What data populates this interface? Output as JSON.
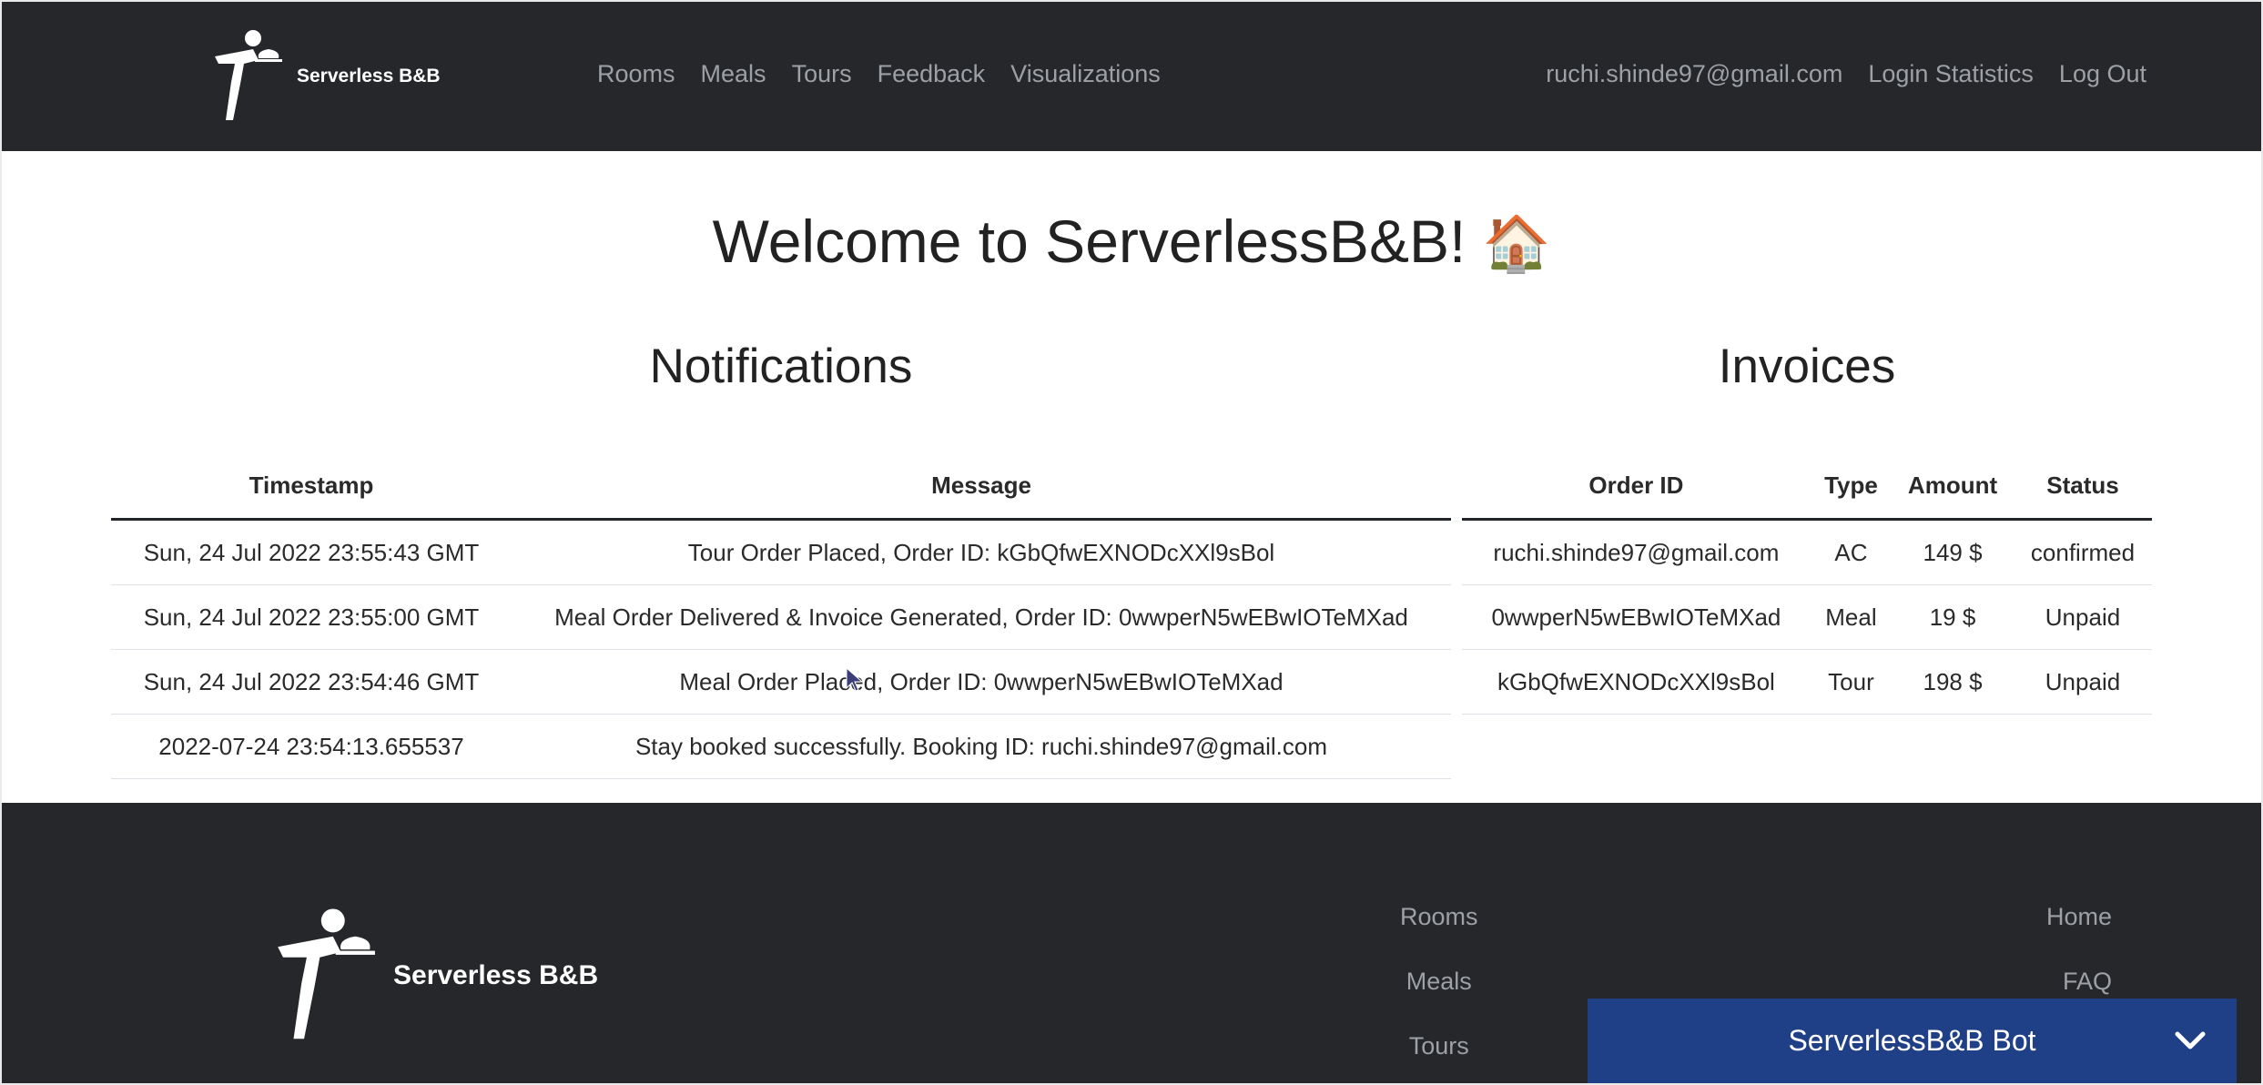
{
  "brand": {
    "name": "Serverless B&B",
    "logo_icon": "waiter-with-tray-icon"
  },
  "nav": {
    "links": [
      "Rooms",
      "Meals",
      "Tours",
      "Feedback",
      "Visualizations"
    ],
    "user_email": "ruchi.shinde97@gmail.com",
    "login_statistics": "Login Statistics",
    "logout": "Log Out"
  },
  "main": {
    "welcome": "Welcome to ServerlessB&B!",
    "welcome_emoji": "🏠",
    "notifications": {
      "title": "Notifications",
      "columns": [
        "Timestamp",
        "Message"
      ],
      "rows": [
        [
          "Sun, 24 Jul 2022 23:55:43 GMT",
          "Tour Order Placed, Order ID: kGbQfwEXNODcXXl9sBol"
        ],
        [
          "Sun, 24 Jul 2022 23:55:00 GMT",
          "Meal Order Delivered & Invoice Generated, Order ID: 0wwperN5wEBwIOTeMXad"
        ],
        [
          "Sun, 24 Jul 2022 23:54:46 GMT",
          "Meal Order Placed, Order ID: 0wwperN5wEBwIOTeMXad"
        ],
        [
          "2022-07-24 23:54:13.655537",
          "Stay booked successfully. Booking ID: ruchi.shinde97@gmail.com"
        ]
      ]
    },
    "invoices": {
      "title": "Invoices",
      "columns": [
        "Order ID",
        "Type",
        "Amount",
        "Status"
      ],
      "rows": [
        [
          "ruchi.shinde97@gmail.com",
          "AC",
          "149 $",
          "confirmed"
        ],
        [
          "0wwperN5wEBwIOTeMXad",
          "Meal",
          "19 $",
          "Unpaid"
        ],
        [
          "kGbQfwEXNODcXXl9sBol",
          "Tour",
          "198 $",
          "Unpaid"
        ]
      ]
    }
  },
  "footer": {
    "brand": "Serverless B&B",
    "col1": [
      "Rooms",
      "Meals",
      "Tours"
    ],
    "col2": [
      "Home",
      "FAQ"
    ]
  },
  "bot": {
    "title": "ServerlessB&B Bot",
    "toggle_icon": "chevron-down-icon"
  },
  "colors": {
    "navbar_bg": "#25272b",
    "bot_bg": "#1f3f86",
    "nav_link": "#9da0a4"
  }
}
